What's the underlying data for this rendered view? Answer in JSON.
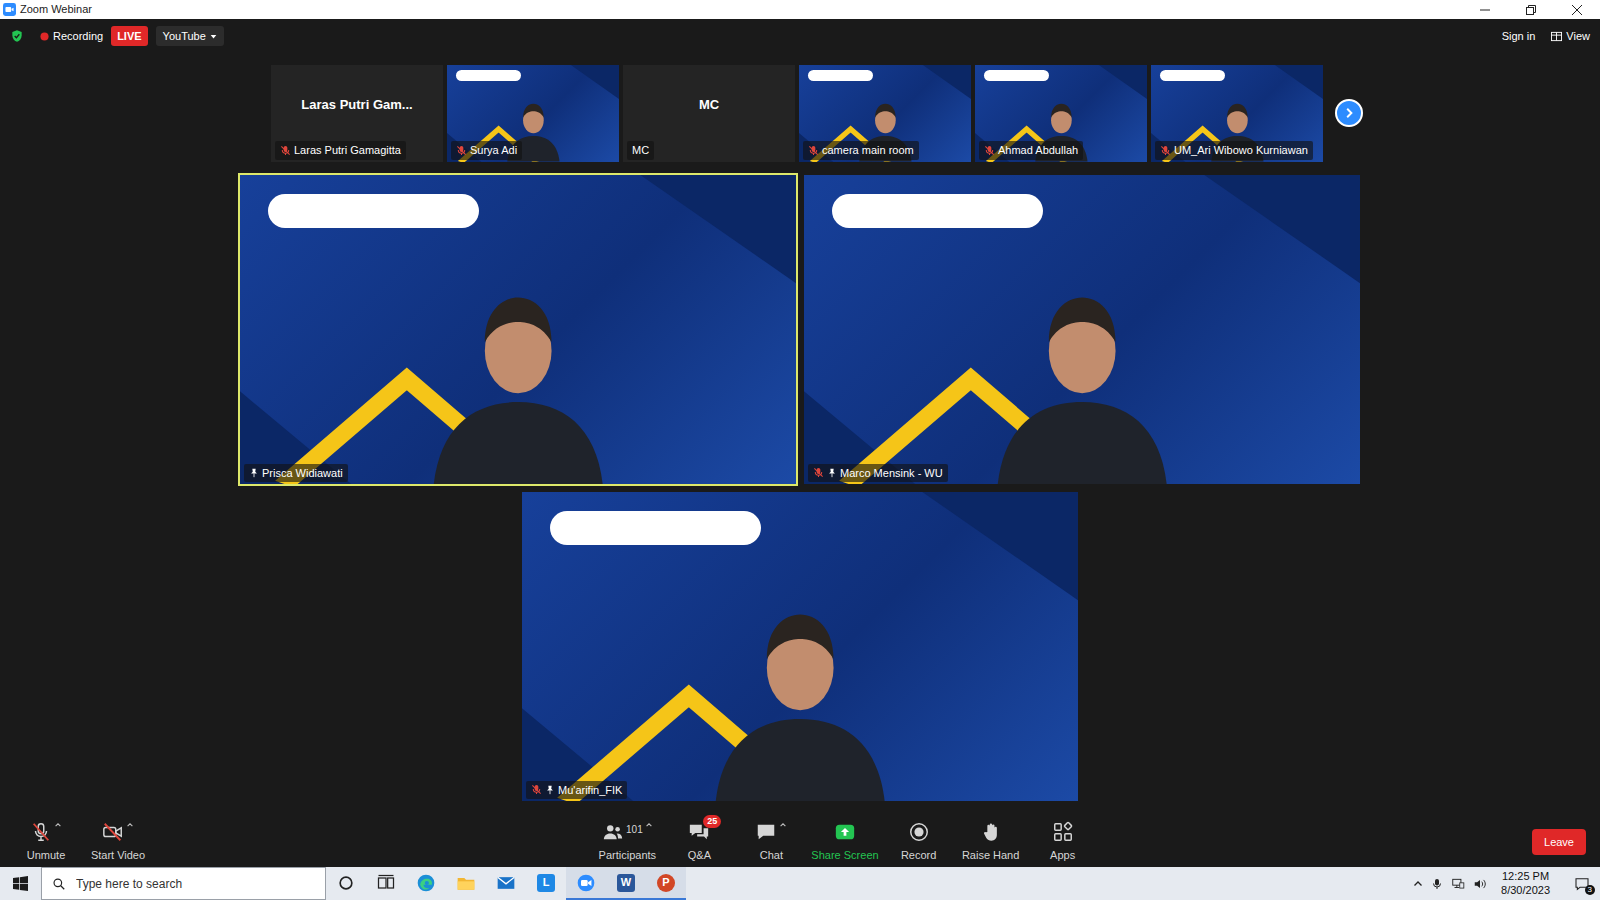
{
  "window": {
    "title": "Zoom Webinar"
  },
  "meeting_bar": {
    "secure": true,
    "recording": "Recording",
    "live": "LIVE",
    "stream": "YouTube",
    "sign_in": "Sign in",
    "view": "View"
  },
  "thumbnails": [
    {
      "kind": "name",
      "display": "Laras Putri Gam...",
      "name": "Laras Putri Gamagitta",
      "muted": true
    },
    {
      "kind": "video",
      "name": "Surya Adi",
      "muted": true
    },
    {
      "kind": "name",
      "display": "MC",
      "name": "MC",
      "muted": false
    },
    {
      "kind": "video",
      "name": "camera main room",
      "muted": true
    },
    {
      "kind": "video",
      "name": "Ahmad Abdullah",
      "muted": true
    },
    {
      "kind": "video",
      "name": "UM_Ari Wibowo Kurniawan",
      "muted": true
    }
  ],
  "gallery": [
    {
      "name": "Prisca Widiawati",
      "muted": false,
      "spotlight": true,
      "speaking": true
    },
    {
      "name": "Marco Mensink - WU",
      "muted": true,
      "spotlight": true,
      "speaking": false
    },
    {
      "name": "Mu'arifin_FIK",
      "muted": true,
      "spotlight": true,
      "speaking": false
    }
  ],
  "toolbar": {
    "left": [
      {
        "kind": "mic-off",
        "label": "Unmute",
        "menu": true
      },
      {
        "kind": "video-off",
        "label": "Start Video",
        "menu": true
      }
    ],
    "center": [
      {
        "kind": "participants",
        "label": "Participants",
        "count": "101",
        "menu": true
      },
      {
        "kind": "qa",
        "label": "Q&A",
        "badge": "25",
        "menu": false
      },
      {
        "kind": "chat",
        "label": "Chat",
        "menu": true
      },
      {
        "kind": "share",
        "label": "Share Screen",
        "menu": false
      },
      {
        "kind": "record",
        "label": "Record",
        "menu": false
      },
      {
        "kind": "hand",
        "label": "Raise Hand",
        "menu": false
      },
      {
        "kind": "apps",
        "label": "Apps",
        "menu": false
      }
    ],
    "leave": "Leave"
  },
  "taskbar": {
    "search": {
      "placeholder": "Type here to search"
    },
    "apps": [
      {
        "kind": "cortana",
        "running": false
      },
      {
        "kind": "taskview",
        "running": false
      },
      {
        "kind": "edge",
        "running": false
      },
      {
        "kind": "explorer",
        "running": false
      },
      {
        "kind": "mail",
        "running": false
      },
      {
        "kind": "letter",
        "glyph": "L",
        "running": false
      },
      {
        "kind": "zoom",
        "running": true
      },
      {
        "kind": "word",
        "glyph": "W",
        "running": true
      },
      {
        "kind": "powerpoint",
        "glyph": "P",
        "running": true
      }
    ],
    "time": "12:25 PM",
    "date": "8/30/2023",
    "notifications": "3"
  }
}
